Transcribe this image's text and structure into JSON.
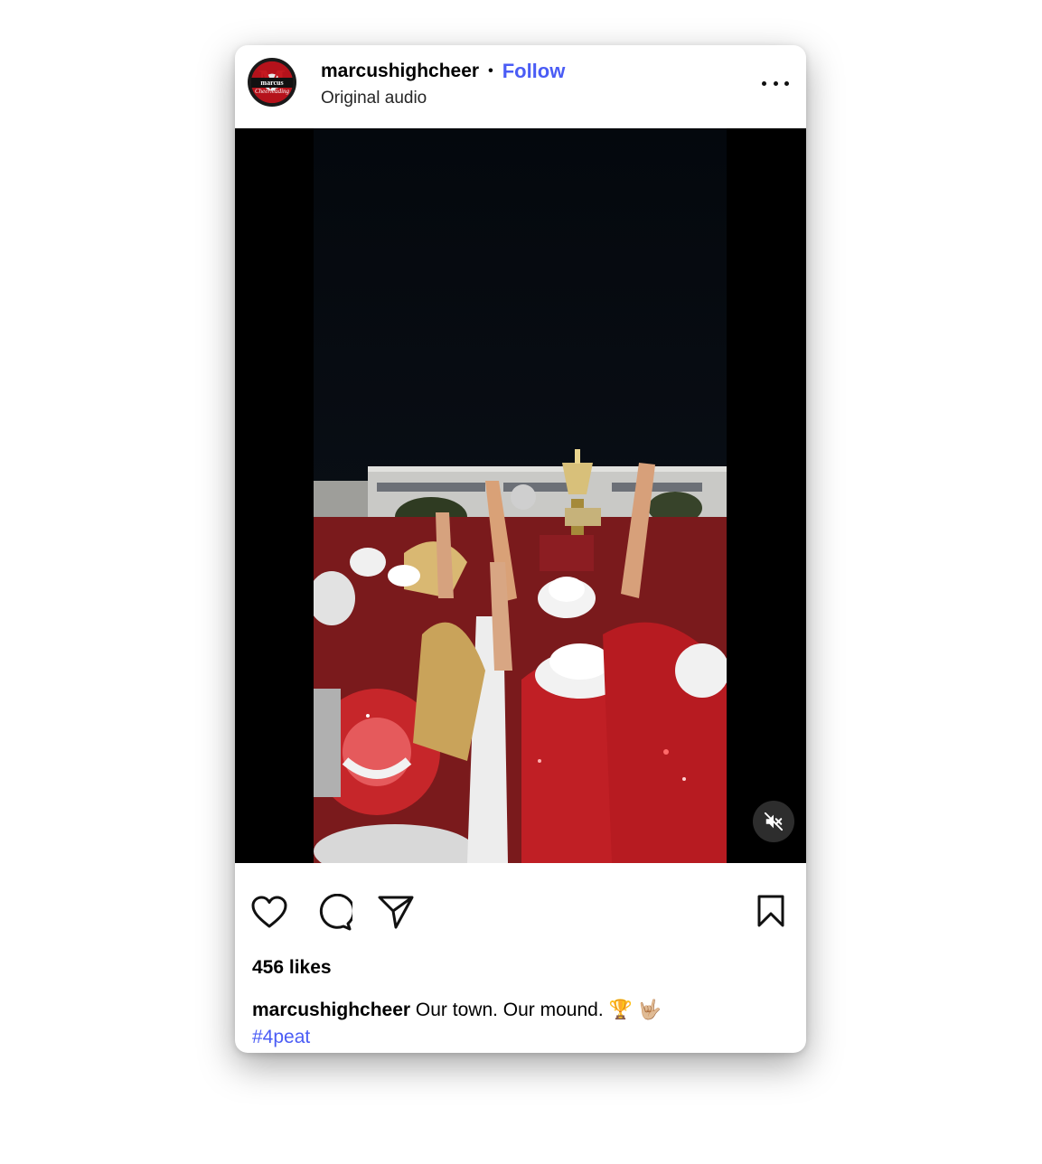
{
  "post": {
    "username": "marcushighcheer",
    "separator": "•",
    "follow_label": "Follow",
    "audio_label": "Original audio",
    "likes_text": "456 likes",
    "caption_user": "marcushighcheer",
    "caption_text": "Our town. Our mound.",
    "caption_emojis": "🏆 🤟🏼",
    "hashtag": "#4peat"
  },
  "avatar": {
    "logo_letter": "M",
    "logo_band": "marcus",
    "logo_script": "Cheerleading"
  },
  "icons": {
    "more": "more-options-icon",
    "mute": "muted-speaker-icon",
    "like": "heart-icon",
    "comment": "comment-icon",
    "share": "send-icon",
    "save": "bookmark-icon"
  },
  "colors": {
    "accent": "#4a5cf5",
    "brand_red": "#b5121b",
    "video_bg": "#000000"
  }
}
